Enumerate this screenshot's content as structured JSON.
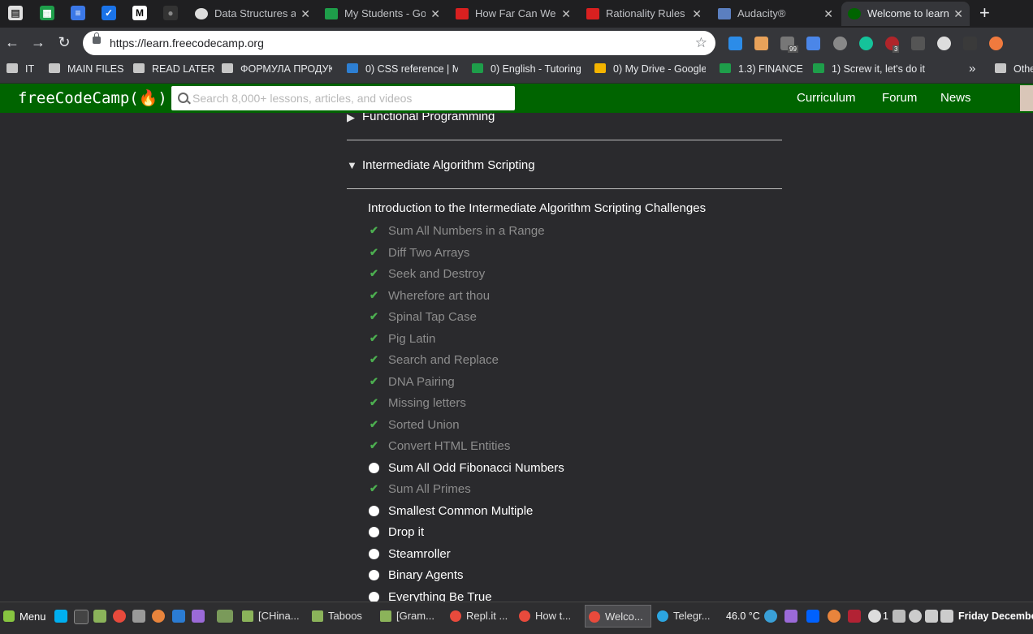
{
  "browser": {
    "tabs": [
      {
        "title": "Data Structures a",
        "icon": "github-octocat-icon"
      },
      {
        "title": "My Students - Go",
        "icon": "sheets-icon"
      },
      {
        "title": "How Far Can We",
        "icon": "youtube-icon"
      },
      {
        "title": "Rationality Rules",
        "icon": "youtube-icon"
      },
      {
        "title": "Audacity®",
        "icon": "audacity-icon"
      },
      {
        "title": "Welcome to learn",
        "icon": "freecodecamp-icon"
      }
    ],
    "url": "https://learn.freecodecamp.org",
    "bookmarks": [
      {
        "label": "IT"
      },
      {
        "label": "MAIN FILES"
      },
      {
        "label": "READ LATER"
      },
      {
        "label": "ФОРМУЛА ПРОДУК"
      },
      {
        "label": "0) CSS reference | M"
      },
      {
        "label": "0) English - Tutoring"
      },
      {
        "label": "0) My Drive - Google"
      },
      {
        "label": "1.3) FINANCE"
      },
      {
        "label": "1) Screw it, let's do it"
      },
      {
        "label": "»"
      },
      {
        "label": "Othe"
      }
    ],
    "badges": {
      "ext1": "99",
      "ext2": "3"
    }
  },
  "fcc": {
    "logo": "freeCodeCamp(🔥)",
    "search_placeholder": "Search 8,000+ lessons, articles, and videos",
    "nav": [
      "Curriculum",
      "Forum",
      "News"
    ]
  },
  "curriculum": {
    "collapsed_section": "Functional Programming",
    "expanded_section": "Intermediate Algorithm Scripting",
    "intro": "Introduction to the Intermediate Algorithm Scripting Challenges",
    "challenges": [
      {
        "title": "Sum All Numbers in a Range",
        "done": true
      },
      {
        "title": "Diff Two Arrays",
        "done": true
      },
      {
        "title": "Seek and Destroy",
        "done": true
      },
      {
        "title": "Wherefore art thou",
        "done": true
      },
      {
        "title": "Spinal Tap Case",
        "done": true
      },
      {
        "title": "Pig Latin",
        "done": true
      },
      {
        "title": "Search and Replace",
        "done": true
      },
      {
        "title": "DNA Pairing",
        "done": true
      },
      {
        "title": "Missing letters",
        "done": true
      },
      {
        "title": "Sorted Union",
        "done": true
      },
      {
        "title": "Convert HTML Entities",
        "done": true
      },
      {
        "title": "Sum All Odd Fibonacci Numbers",
        "done": false
      },
      {
        "title": "Sum All Primes",
        "done": true
      },
      {
        "title": "Smallest Common Multiple",
        "done": false
      },
      {
        "title": "Drop it",
        "done": false
      },
      {
        "title": "Steamroller",
        "done": false
      },
      {
        "title": "Binary Agents",
        "done": false
      },
      {
        "title": "Everything Be True",
        "done": false
      }
    ]
  },
  "taskbar": {
    "menu": "Menu",
    "tasks": [
      {
        "label": "[CHina..."
      },
      {
        "label": "Taboos"
      },
      {
        "label": "[Gram..."
      },
      {
        "label": "Repl.it ..."
      },
      {
        "label": "How t..."
      },
      {
        "label": "Welco..."
      },
      {
        "label": "Telegr..."
      }
    ],
    "temperature": "46.0 °C",
    "notif_count": "1",
    "date": "Friday Decembe"
  }
}
